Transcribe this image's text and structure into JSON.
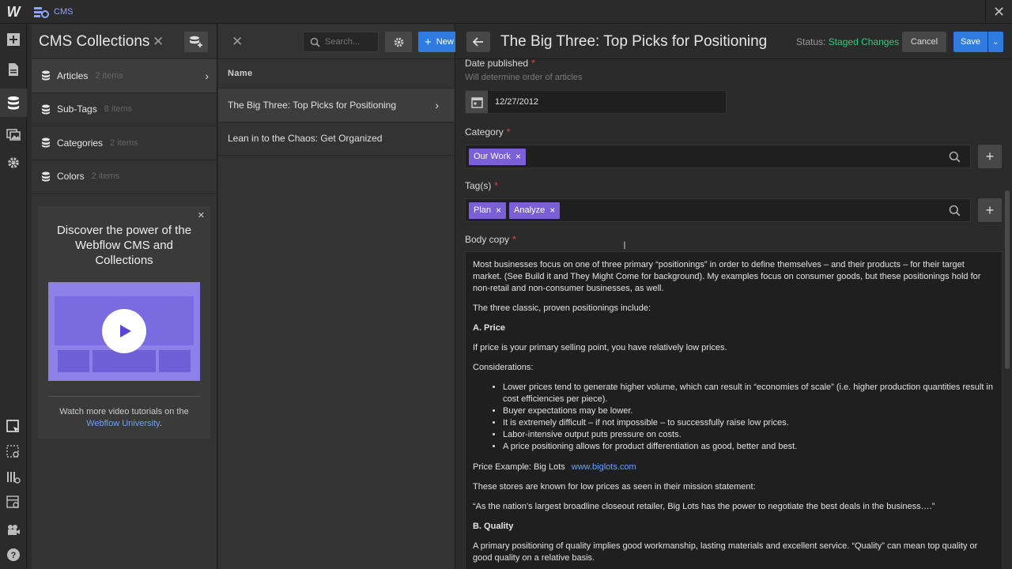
{
  "topbar": {
    "logo": "W",
    "section_label": "CMS",
    "close": "✕"
  },
  "rail": {
    "icons": [
      "add-icon",
      "pages-icon",
      "cms-icon",
      "assets-icon",
      "settings-icon",
      "select-icon",
      "preview-icon",
      "grid-icon",
      "layout-icon",
      "video-icon",
      "help-icon"
    ]
  },
  "collections": {
    "title": "CMS Collections",
    "close": "✕",
    "items": [
      {
        "name": "Articles",
        "count": "2 items"
      },
      {
        "name": "Sub-Tags",
        "count": "8 items"
      },
      {
        "name": "Categories",
        "count": "2 items"
      },
      {
        "name": "Colors",
        "count": "2 items"
      }
    ],
    "promo": {
      "close": "✕",
      "title": "Discover the power of the Webflow CMS and Collections",
      "footer_text": "Watch more video tutorials on the",
      "footer_link": "Webflow University",
      "footer_end": "."
    }
  },
  "list": {
    "close": "✕",
    "search_placeholder": "Search...",
    "new_label": "New",
    "column_header": "Name",
    "rows": [
      "The Big Three: Top Picks for Positioning",
      "Lean in to the Chaos: Get Organized"
    ]
  },
  "editor": {
    "title": "The Big Three: Top Picks for Positioning",
    "status_label": "Status:",
    "status_value": "Staged Changes",
    "cancel": "Cancel",
    "save": "Save",
    "fields": {
      "date_label": "Date published",
      "date_hint": "Will determine order of articles",
      "date_value": "12/27/2012",
      "category_label": "Category",
      "category_chips": [
        "Our Work"
      ],
      "tags_label": "Tag(s)",
      "tags_chips": [
        "Plan",
        "Analyze"
      ],
      "body_label": "Body copy",
      "required_mark": "*"
    },
    "body": {
      "p1": "Most businesses focus on one of three primary “positionings” in order to define themselves – and their products – for their target market. (See Build it and They Might Come for background). My examples focus on consumer goods, but these positionings hold for non-retail and non-consumer businesses, as well.",
      "p2": "The three classic, proven positionings include:",
      "h_a": "A. Price",
      "p3": "If price is your primary selling point, you have relatively low prices.",
      "p4": "Considerations:",
      "bullets": [
        "Lower prices tend to generate higher volume, which can result in “economies of scale” (i.e. higher production quantities result in cost efficiencies per piece).",
        "Buyer expectations may be lower.",
        "It is extremely difficult – if not impossible – to successfully raise low prices.",
        "Labor-intensive output puts pressure on costs.",
        "A price positioning allows for product differentiation as good, better and best."
      ],
      "example_label": "Price Example:  Big Lots",
      "example_link": "www.biglots.com",
      "p5": "These stores are known for low prices as seen in their mission statement:",
      "quote": "“As the nation’s largest broadline closeout retailer, Big Lots has the power to negotiate the best deals in the business….”",
      "h_b": "B. Quality",
      "p6": "A primary positioning of quality implies good workmanship, lasting materials and excellent service. “Quality” can mean top quality or good quality on a relative basis."
    }
  },
  "colors": {
    "accent_blue": "#2f7be0",
    "status_green": "#30c97e",
    "chip_purple": "#7b5fd6",
    "required_red": "#e04848",
    "link_blue": "#6aa0ff"
  }
}
